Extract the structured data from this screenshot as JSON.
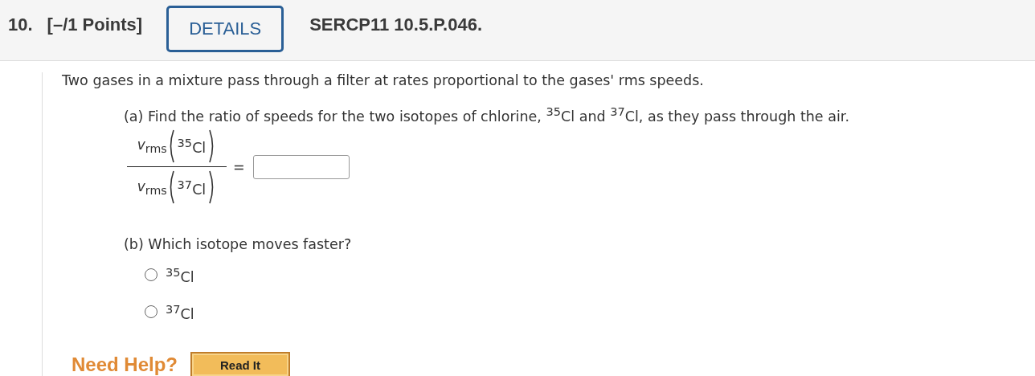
{
  "header": {
    "number": "10.",
    "points": "[–/1 Points]",
    "details_button": "DETAILS",
    "problem_id": "SERCP11 10.5.P.046."
  },
  "intro": "Two gases in a mixture pass through a filter at rates proportional to the gases' rms speeds.",
  "part_a": {
    "prompt": "(a) Find the ratio of speeds for the two isotopes of chlorine, $^{35}$Cl and $^{37}$Cl, as they pass through the air.",
    "numerator": {
      "symbol": "*v*$_{rms}$",
      "isotope": "$^{35}$Cl"
    },
    "denominator": {
      "symbol": "*v*$_{rms}$",
      "isotope": "$^{37}$Cl"
    },
    "equals": "="
  },
  "part_b": {
    "prompt": "(b) Which isotope moves faster?",
    "options": [
      {
        "label": "$^{35}$Cl",
        "selected": false
      },
      {
        "label": "$^{37}$Cl",
        "selected": false
      }
    ]
  },
  "help": {
    "label": "Need Help?",
    "button": "Read It"
  }
}
